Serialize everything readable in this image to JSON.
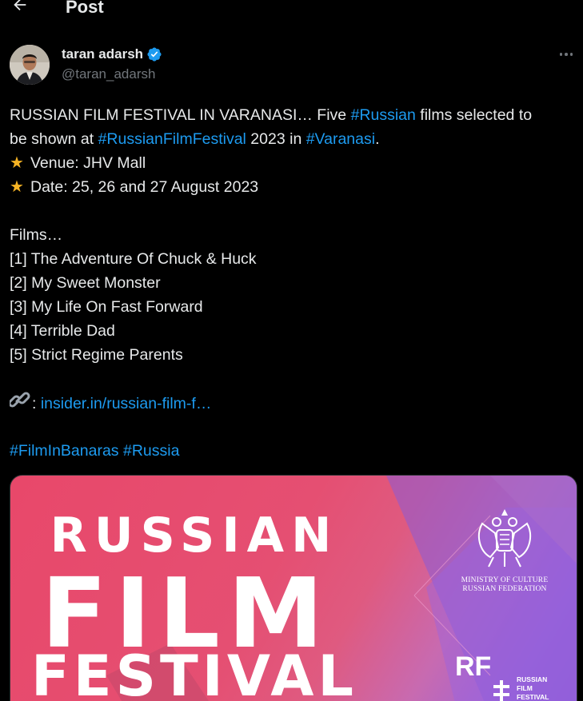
{
  "header": {
    "title": "Post"
  },
  "author": {
    "name": "taran adarsh",
    "handle": "@taran_adarsh"
  },
  "tweet": {
    "line1": {
      "text_a": "RUSSIAN FILM FESTIVAL IN VARANASI… Five ",
      "tag_russian": "#Russian",
      "text_b": " films selected to"
    },
    "line2": {
      "text_a": "be shown at ",
      "tag_festival": "#RussianFilmFestival",
      "text_b": " 2023 in ",
      "tag_varanasi": "#Varanasi",
      "text_c": "."
    },
    "venue": "Venue: JHV Mall",
    "date": "Date: 25, 26 and 27 August 2023",
    "films_heading": "Films…",
    "films": [
      "[1] The Adventure Of Chuck & Huck",
      "[2] My Sweet Monster",
      "[3] My Life On Fast Forward",
      "[4] Terrible Dad",
      "[5] Strict Regime Parents"
    ],
    "link_prefix": ":",
    "link_text": "insider.in/russian-film-f…",
    "hashtags": [
      "#FilmInBanaras",
      "#Russia"
    ]
  },
  "media": {
    "word1": "RUSSIAN",
    "word2": "FILM",
    "word3": "FESTIVAL",
    "ministry_line1": "MINISTRY OF CULTURE",
    "ministry_line2": "RUSSIAN FEDERATION",
    "logo_rf": "RF",
    "logo_line1": "RUSSIAN",
    "logo_line2": "FILM",
    "logo_line3": "FESTIVAL"
  },
  "colors": {
    "background": "#000000",
    "text": "#e7e9ea",
    "muted": "#71767b",
    "link": "#1d9bf0",
    "verified": "#1d9bf0",
    "star": "#f5b324",
    "poster_pink": "#e8486a",
    "poster_purple": "#8d5ad8"
  },
  "icons": {
    "back": "arrow-left-icon",
    "verified": "verified-badge-icon",
    "more": "more-horizontal-icon",
    "star": "star-emoji-icon",
    "link": "chain-link-emoji-icon"
  }
}
